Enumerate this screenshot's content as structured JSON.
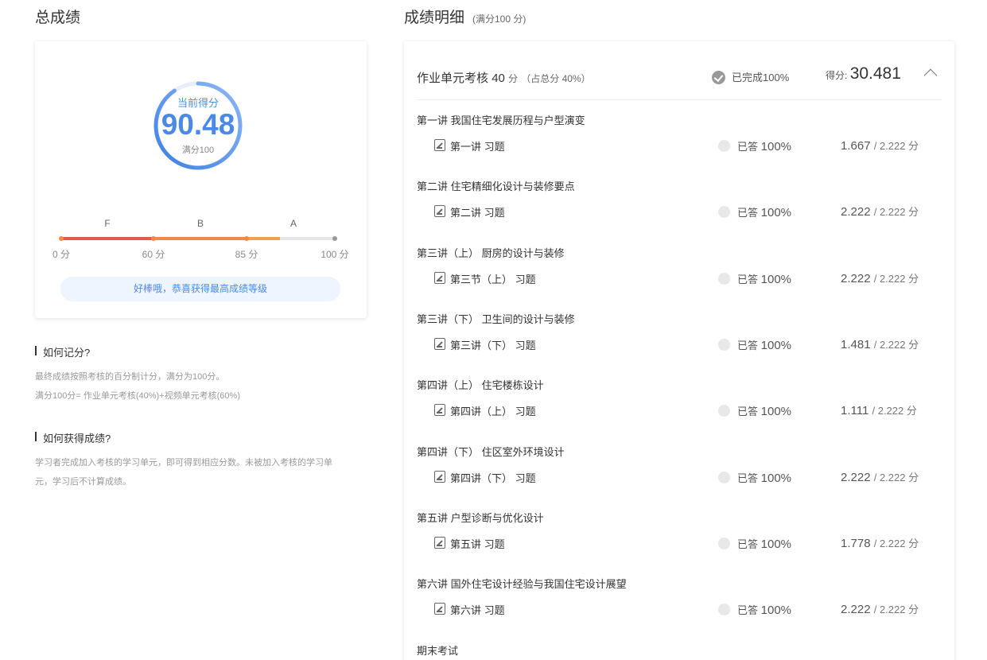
{
  "overall": {
    "title": "总成绩",
    "gauge_label": "当前得分",
    "score": "90.48",
    "score_fraction": 0.9048,
    "full_label": "满分100",
    "grades": [
      "F",
      "B",
      "A"
    ],
    "ticks": [
      "0 分",
      "60 分",
      "85 分",
      "100 分"
    ],
    "praise": "好棒哦，恭喜获得最高成绩等级",
    "colors": {
      "gauge": "#4a8ae6",
      "F": "#e05b4e",
      "B": "#ef8a4a",
      "A": "#f0a050"
    }
  },
  "faq": [
    {
      "question": "如何记分?",
      "answer": [
        "最终成绩按照考核的百分制计分，满分为100分。",
        "满分100分= 作业单元考核(40%)+视频单元考核(60%)"
      ]
    },
    {
      "question": "如何获得成绩?",
      "answer": [
        "学习者完成加入考核的学习单元，即可得到相应分数。未被加入考核的学习单",
        "元，学习后不计算成绩。"
      ]
    }
  ],
  "detail": {
    "title": "成绩明细",
    "subtitle": "(满分100 分)",
    "unit": {
      "name": "作业单元考核",
      "points": "40",
      "unit_label": "分",
      "weight": "（占总分 40%）",
      "status_label": "已完成",
      "status_pct": "100%",
      "score_label": "得分:",
      "score": "30.481"
    },
    "lectures": [
      {
        "title": "第一讲 我国住宅发展历程与户型演变",
        "exercise": "第一讲 习题",
        "status": "已答",
        "pct": "100%",
        "score": "1.667",
        "total": "/ 2.222 分"
      },
      {
        "title": "第二讲 住宅精细化设计与装修要点",
        "exercise": "第二讲 习题",
        "status": "已答",
        "pct": "100%",
        "score": "2.222",
        "total": "/ 2.222 分"
      },
      {
        "title": "第三讲（上） 厨房的设计与装修",
        "exercise": "第三节（上） 习题",
        "status": "已答",
        "pct": "100%",
        "score": "2.222",
        "total": "/ 2.222 分"
      },
      {
        "title": "第三讲（下） 卫生间的设计与装修",
        "exercise": "第三讲（下） 习题",
        "status": "已答",
        "pct": "100%",
        "score": "1.481",
        "total": "/ 2.222 分"
      },
      {
        "title": "第四讲（上） 住宅楼栋设计",
        "exercise": "第四讲（上） 习题",
        "status": "已答",
        "pct": "100%",
        "score": "1.111",
        "total": "/ 2.222 分"
      },
      {
        "title": "第四讲（下） 住区室外环境设计",
        "exercise": "第四讲（下） 习题",
        "status": "已答",
        "pct": "100%",
        "score": "2.222",
        "total": "/ 2.222 分"
      },
      {
        "title": "第五讲 户型诊断与优化设计",
        "exercise": "第五讲 习题",
        "status": "已答",
        "pct": "100%",
        "score": "1.778",
        "total": "/ 2.222 分"
      },
      {
        "title": "第六讲 国外住宅设计经验与我国住宅设计展望",
        "exercise": "第六讲 习题",
        "status": "已答",
        "pct": "100%",
        "score": "2.222",
        "total": "/ 2.222 分"
      }
    ],
    "final_exam": "期末考试"
  }
}
